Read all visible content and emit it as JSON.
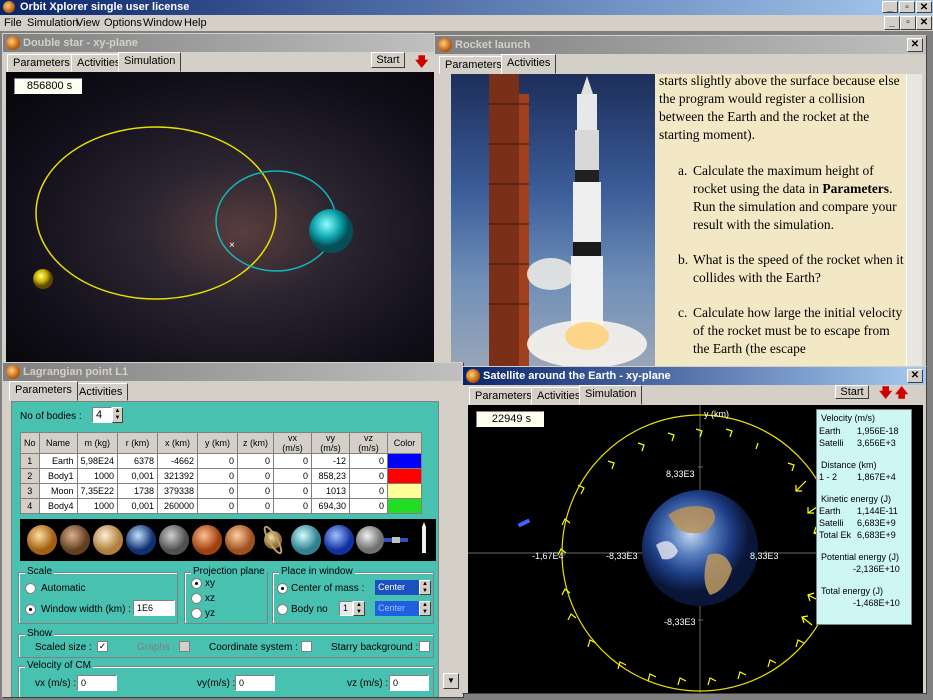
{
  "app": {
    "title": "Orbit Xplorer single user license",
    "menu": [
      "File",
      "Simulation",
      "View",
      "Options",
      "Window",
      "Help"
    ],
    "win_buttons": [
      "_",
      "▫",
      "✕"
    ]
  },
  "double_star": {
    "title": "Double star - xy-plane",
    "tabs": [
      "Parameters",
      "Activities",
      "Simulation"
    ],
    "start": "Start",
    "time": "856800 s"
  },
  "rocket": {
    "title": "Rocket launch",
    "tabs": [
      "Parameters",
      "Activities"
    ],
    "text_intro": "starts slightly above the surface because else the program would register a collision between the Earth and the rocket at the starting moment).",
    "item_a_label": "a.",
    "item_a_pre": "Calculate the maximum height of rocket using the data in ",
    "item_a_bold": "Parameters",
    "item_a_post": ". Run the simulation and compare your result with the simulation.",
    "item_b_label": "b.",
    "item_b": "What is the speed of the rocket when it collides with the Earth?",
    "item_c_label": "c.",
    "item_c": "Calculate how large the initial velocity of the rocket  must be to escape from the Earth (the escape"
  },
  "lagrange": {
    "title": "Lagrangian point L1",
    "tabs": [
      "Parameters",
      "Activities"
    ],
    "bodies_label": "No of bodies :",
    "bodies_value": "4",
    "columns": [
      "No",
      "Name",
      "m (kg)",
      "r (km)",
      "x (km)",
      "y (km)",
      "z (km)",
      "vx (m/s)",
      "vy (m/s)",
      "vz (m/s)",
      "Color"
    ],
    "rows": [
      {
        "no": "1",
        "name": "Earth",
        "m": "5,98E24",
        "r": "6378",
        "x": "-4662",
        "y": "0",
        "z": "0",
        "vx": "0",
        "vy": "-12",
        "vz": "0",
        "color": "#0000ff"
      },
      {
        "no": "2",
        "name": "Body1",
        "m": "1000",
        "r": "0,001",
        "x": "321392",
        "y": "0",
        "z": "0",
        "vx": "0",
        "vy": "858,23",
        "vz": "0",
        "color": "#ff0000"
      },
      {
        "no": "3",
        "name": "Moon",
        "m": "7,35E22",
        "r": "1738",
        "x": "379338",
        "y": "0",
        "z": "0",
        "vx": "0",
        "vy": "1013",
        "vz": "0",
        "color": "#ffff99"
      },
      {
        "no": "4",
        "name": "Body4",
        "m": "1000",
        "r": "0,001",
        "x": "260000",
        "y": "0",
        "z": "0",
        "vx": "0",
        "vy": "694,30",
        "vz": "0",
        "color": "#22dd22"
      }
    ],
    "scale_title": "Scale",
    "scale_auto": "Automatic",
    "scale_width": "Window width (km) :",
    "scale_width_value": "1E6",
    "proj_title": "Projection plane",
    "proj_options": [
      "xy",
      "xz",
      "yz"
    ],
    "place_title": "Place in window",
    "place_com": "Center of mass :",
    "place_com_value": "Center",
    "place_body": "Body no",
    "place_body_value": "1",
    "place_body_select": "Center",
    "show_title": "Show",
    "show_scaled": "Scaled size :",
    "show_graphs": "Graphs :",
    "show_coord": "Coordinate system :",
    "show_starry": "Starry background :",
    "vel_title": "Velocity of CM",
    "vx_label": "vx (m/s) :",
    "vx_value": "0",
    "vy_label": "vy(m/s) :",
    "vy_value": "0",
    "vz_label": "vz (m/s) :",
    "vz_value": "0"
  },
  "satellite": {
    "title": "Satellite around the Earth - xy-plane",
    "tabs": [
      "Parameters",
      "Activities",
      "Simulation"
    ],
    "start": "Start",
    "time": "22949 s",
    "axis_y": "y (km)",
    "labels": {
      "top": "8,33E3",
      "bottom": "-8,33E3",
      "left_outer": "-1,67E4",
      "left_inner": "-8,33E3",
      "right": "8,33E3"
    },
    "stats": {
      "vel_title": "Velocity (m/s)",
      "vel_earth_k": "Earth",
      "vel_earth_v": "1,956E-18",
      "vel_sat_k": "Satelli",
      "vel_sat_v": "3,656E+3",
      "dist_title": "Distance (km)",
      "dist_k": "1 - 2",
      "dist_v": "1,867E+4",
      "ke_title": "Kinetic energy (J)",
      "ke_earth_k": "Earth",
      "ke_earth_v": "1,144E-11",
      "ke_sat_k": "Satelli",
      "ke_sat_v": "6,683E+9",
      "ke_tot_k": "Total Ek",
      "ke_tot_v": "6,683E+9",
      "pe_title": "Potential energy (J)",
      "pe_v": "-2,136E+10",
      "te_title": "Total energy (J)",
      "te_v": "-1,468E+10"
    }
  },
  "colors": {
    "titlebar": "#0a246a",
    "teal": "#49c1b0",
    "orbit": "#ffff00",
    "panel": "#d4d0c8"
  }
}
